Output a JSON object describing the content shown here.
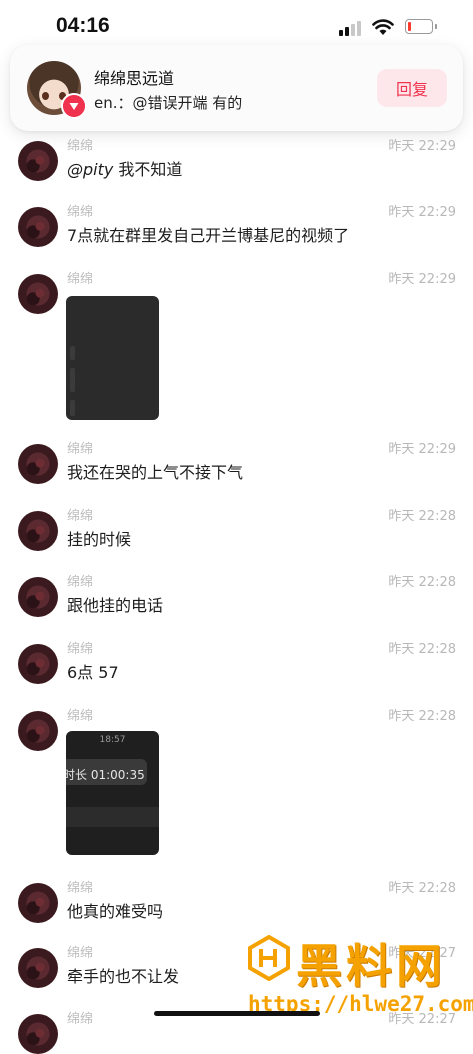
{
  "status_bar": {
    "time": "04:16",
    "battery_color": "#ff3b30"
  },
  "notification": {
    "title": "绵绵思远道",
    "body": "en.：@错误开端 有的",
    "reply_label": "回复",
    "badge_color": "#f0324f"
  },
  "messages": [
    {
      "sender": "绵绵",
      "time": "昨天 22:29",
      "mention": "@pity",
      "text": " 我不知道"
    },
    {
      "sender": "绵绵",
      "time": "昨天 22:29",
      "text": "7点就在群里发自己开兰博基尼的视频了"
    },
    {
      "sender": "绵绵",
      "time": "昨天 22:29",
      "attachment": "image"
    },
    {
      "sender": "绵绵",
      "time": "昨天 22:29",
      "text": "我还在哭的上气不接下气"
    },
    {
      "sender": "绵绵",
      "time": "昨天 22:28",
      "text": "挂的时候"
    },
    {
      "sender": "绵绵",
      "time": "昨天 22:28",
      "text": "跟他挂的电话"
    },
    {
      "sender": "绵绵",
      "time": "昨天 22:28",
      "text": "6点 57"
    },
    {
      "sender": "绵绵",
      "time": "昨天 22:28",
      "attachment": "screenshot",
      "screenshot_time": "18:57",
      "screenshot_duration": "时长 01:00:35"
    },
    {
      "sender": "绵绵",
      "time": "昨天 22:28",
      "text": "他真的难受吗"
    },
    {
      "sender": "绵绵",
      "time": "昨天 22:27",
      "text": "牵手的也不让发"
    },
    {
      "sender": "绵绵",
      "time": "昨天 22:27"
    }
  ],
  "watermark": {
    "text": "黑料网",
    "url": "https://hlwe27.com",
    "color": "#f5a200"
  }
}
